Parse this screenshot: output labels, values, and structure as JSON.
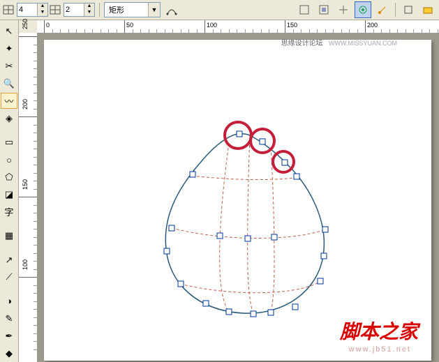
{
  "toolbar": {
    "spinner1": "4",
    "spinner2": "2",
    "shape_dropdown": "矩形"
  },
  "ruler_h": [
    "0",
    "50",
    "100",
    "150",
    "200"
  ],
  "ruler_v": [
    "250",
    "200",
    "150",
    "100"
  ],
  "watermarks": {
    "top_text": "思缘设计论坛",
    "top_url": "WWW.MISSYUAN.COM",
    "bottom_main": "脚本之家",
    "bottom_sub": "www.jb51.net"
  },
  "tools": [
    {
      "name": "pick",
      "icon": "↖"
    },
    {
      "name": "shape",
      "icon": "✦"
    },
    {
      "name": "crop",
      "icon": "✂"
    },
    {
      "name": "zoom",
      "icon": "🔍"
    },
    {
      "name": "freehand",
      "icon": "〰",
      "active": true
    },
    {
      "name": "smart-fill",
      "icon": "◈"
    },
    {
      "name": "spacer"
    },
    {
      "name": "rectangle",
      "icon": "▭"
    },
    {
      "name": "ellipse",
      "icon": "○"
    },
    {
      "name": "polygon",
      "icon": "⬠"
    },
    {
      "name": "basic-shapes",
      "icon": "◪"
    },
    {
      "name": "text",
      "icon": "字"
    },
    {
      "name": "spacer"
    },
    {
      "name": "table",
      "icon": "▦"
    },
    {
      "name": "spacer"
    },
    {
      "name": "dimension",
      "icon": "↗"
    },
    {
      "name": "connector",
      "icon": "⟋"
    },
    {
      "name": "spacer"
    },
    {
      "name": "interactive",
      "icon": "◑"
    },
    {
      "name": "eyedropper",
      "icon": "✎"
    },
    {
      "name": "outline",
      "icon": "✒"
    },
    {
      "name": "fill",
      "icon": "◆"
    }
  ]
}
